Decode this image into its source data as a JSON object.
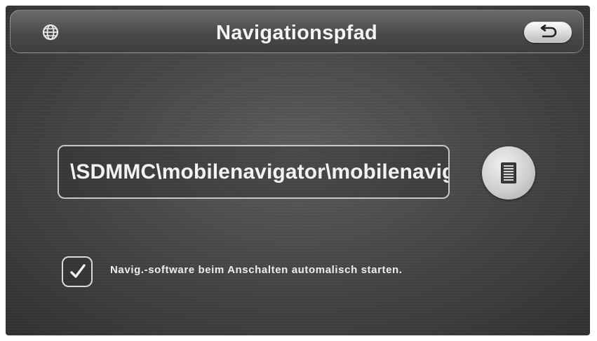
{
  "header": {
    "title": "Navigationspfad",
    "left_icon": "globe-icon",
    "back_icon": "return-arrow-icon"
  },
  "path_field": {
    "value": "\\SDMMC\\mobilenavigator\\mobilenavig"
  },
  "browse_button": {
    "icon": "document-list-icon"
  },
  "autostart": {
    "checked": true,
    "label": "Navig.-software beim Anschalten automalisch starten."
  }
}
